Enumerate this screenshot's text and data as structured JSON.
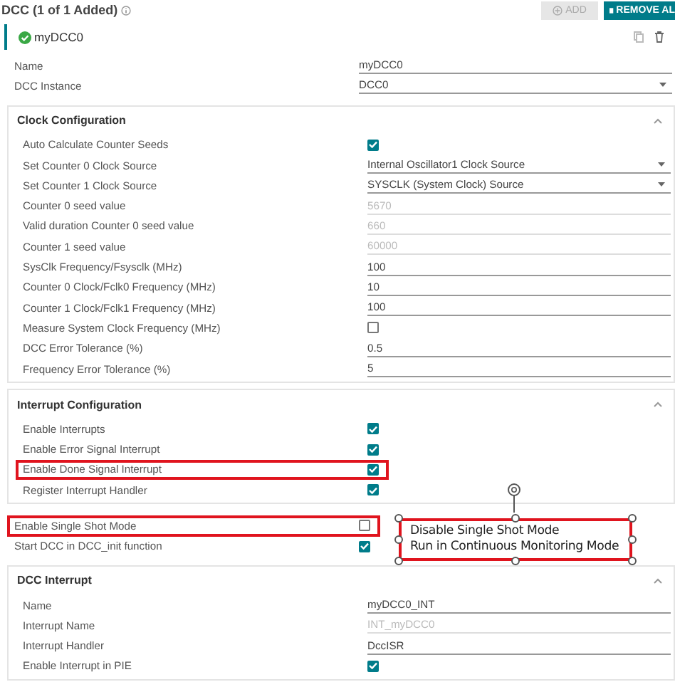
{
  "header": {
    "title": "DCC (1 of 1 Added)",
    "add_button": {
      "label": "ADD",
      "disabled": true
    },
    "remove_button": {
      "label": "REMOVE AL"
    }
  },
  "instance": {
    "name": "myDCC0"
  },
  "blocks": [
    {
      "kind": "rows",
      "rows": [
        {
          "kind": "text",
          "label": "Name",
          "value": "myDCC0",
          "disabled": false,
          "highlighted": false
        },
        {
          "kind": "select",
          "label": "DCC Instance",
          "value": "DCC0",
          "highlighted": false
        }
      ]
    },
    {
      "kind": "section",
      "title": "Clock Configuration",
      "expanded": true,
      "rows": [
        {
          "kind": "checkbox",
          "label": "Auto Calculate Counter Seeds",
          "checked": true,
          "highlighted": false
        },
        {
          "kind": "select",
          "label": "Set Counter 0 Clock Source",
          "value": "Internal Oscillator1 Clock Source",
          "highlighted": false
        },
        {
          "kind": "select",
          "label": "Set Counter 1 Clock Source",
          "value": "SYSCLK (System Clock) Source",
          "highlighted": false
        },
        {
          "kind": "text",
          "label": "Counter 0 seed value",
          "value": "5670",
          "disabled": true,
          "highlighted": false
        },
        {
          "kind": "text",
          "label": "Valid duration Counter 0 seed value",
          "value": "660",
          "disabled": true,
          "highlighted": false
        },
        {
          "kind": "text",
          "label": "Counter 1 seed value",
          "value": "60000",
          "disabled": true,
          "highlighted": false
        },
        {
          "kind": "text",
          "label": "SysClk Frequency/Fsysclk (MHz)",
          "value": "100",
          "disabled": false,
          "highlighted": false
        },
        {
          "kind": "text",
          "label": "Counter 0 Clock/Fclk0 Frequency (MHz)",
          "value": "10",
          "disabled": false,
          "highlighted": false
        },
        {
          "kind": "text",
          "label": "Counter 1 Clock/Fclk1 Frequency (MHz)",
          "value": "100",
          "disabled": false,
          "highlighted": false
        },
        {
          "kind": "checkbox",
          "label": "Measure System Clock Frequency (MHz)",
          "checked": false,
          "highlighted": false
        },
        {
          "kind": "text",
          "label": "DCC Error Tolerance (%)",
          "value": "0.5",
          "disabled": false,
          "highlighted": false
        },
        {
          "kind": "text",
          "label": "Frequency Error Tolerance (%)",
          "value": "5",
          "disabled": false,
          "highlighted": false
        }
      ]
    },
    {
      "kind": "section",
      "title": "Interrupt Configuration",
      "expanded": true,
      "rows": [
        {
          "kind": "checkbox",
          "label": "Enable Interrupts",
          "checked": true,
          "highlighted": false
        },
        {
          "kind": "checkbox",
          "label": "Enable Error Signal Interrupt",
          "checked": true,
          "highlighted": false
        },
        {
          "kind": "checkbox",
          "label": "Enable Done Signal Interrupt",
          "checked": true,
          "highlighted": true
        },
        {
          "kind": "checkbox",
          "label": "Register Interrupt Handler",
          "checked": true,
          "highlighted": false
        }
      ]
    },
    {
      "kind": "rows",
      "rows": [
        {
          "kind": "checkbox",
          "label": "Enable Single Shot Mode",
          "checked": false,
          "highlighted": true
        },
        {
          "kind": "checkbox",
          "label": "Start DCC in DCC_init function",
          "checked": true,
          "highlighted": false
        }
      ]
    },
    {
      "kind": "section",
      "title": "DCC Interrupt",
      "expanded": true,
      "rows": [
        {
          "kind": "text",
          "label": "Name",
          "value": "myDCC0_INT",
          "disabled": false,
          "highlighted": false
        },
        {
          "kind": "text",
          "label": "Interrupt Name",
          "value": "INT_myDCC0",
          "disabled": true,
          "highlighted": false
        },
        {
          "kind": "text",
          "label": "Interrupt Handler",
          "value": "DccISR",
          "disabled": false,
          "highlighted": false
        },
        {
          "kind": "checkbox",
          "label": "Enable Interrupt in PIE",
          "checked": true,
          "highlighted": false
        }
      ]
    }
  ],
  "callout": {
    "lines": [
      "Disable Single Shot Mode",
      "Run in Continuous Monitoring Mode"
    ]
  }
}
